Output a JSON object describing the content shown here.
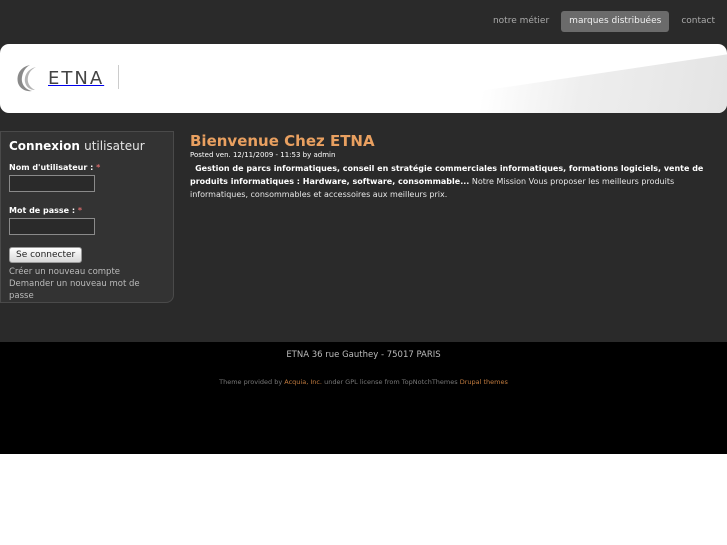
{
  "nav": {
    "items": [
      {
        "label": "notre métier"
      },
      {
        "label": "marques distribuées"
      },
      {
        "label": "contact"
      }
    ]
  },
  "header": {
    "logo_text": "ETNA"
  },
  "login": {
    "title_bold": "Connexion",
    "title_light": "utilisateur",
    "username_label": "Nom d'utilisateur :",
    "password_label": "Mot de passe :",
    "required_mark": "*",
    "submit_label": "Se connecter",
    "create_account": "Créer un nouveau compte",
    "reset_password": "Demander un nouveau mot de passe"
  },
  "article": {
    "title": "Bienvenue Chez ETNA",
    "posted": "Posted ven. 12/11/2009 - 11:53 by admin",
    "lead": "Gestion de parcs informatiques, conseil en stratégie commerciales informatiques, formations logiciels, vente de produits informatiques : Hardware, software, consommable...",
    "body": " Notre Mission Vous proposer les meilleurs produits informatiques, consommables et accessoires aux meilleurs prix."
  },
  "footer": {
    "address": "ETNA 36 rue Gauthey - 75017 PARIS",
    "credit_1": "Theme provided by",
    "credit_link_1": "Acquia, Inc.",
    "credit_2": "under GPL license from TopNotchThemes",
    "credit_link_2": "Drupal themes"
  },
  "colors": {
    "accent_title": "#e9a060",
    "link_footer": "#c07a3e",
    "background_dark": "#2a2a2a"
  }
}
